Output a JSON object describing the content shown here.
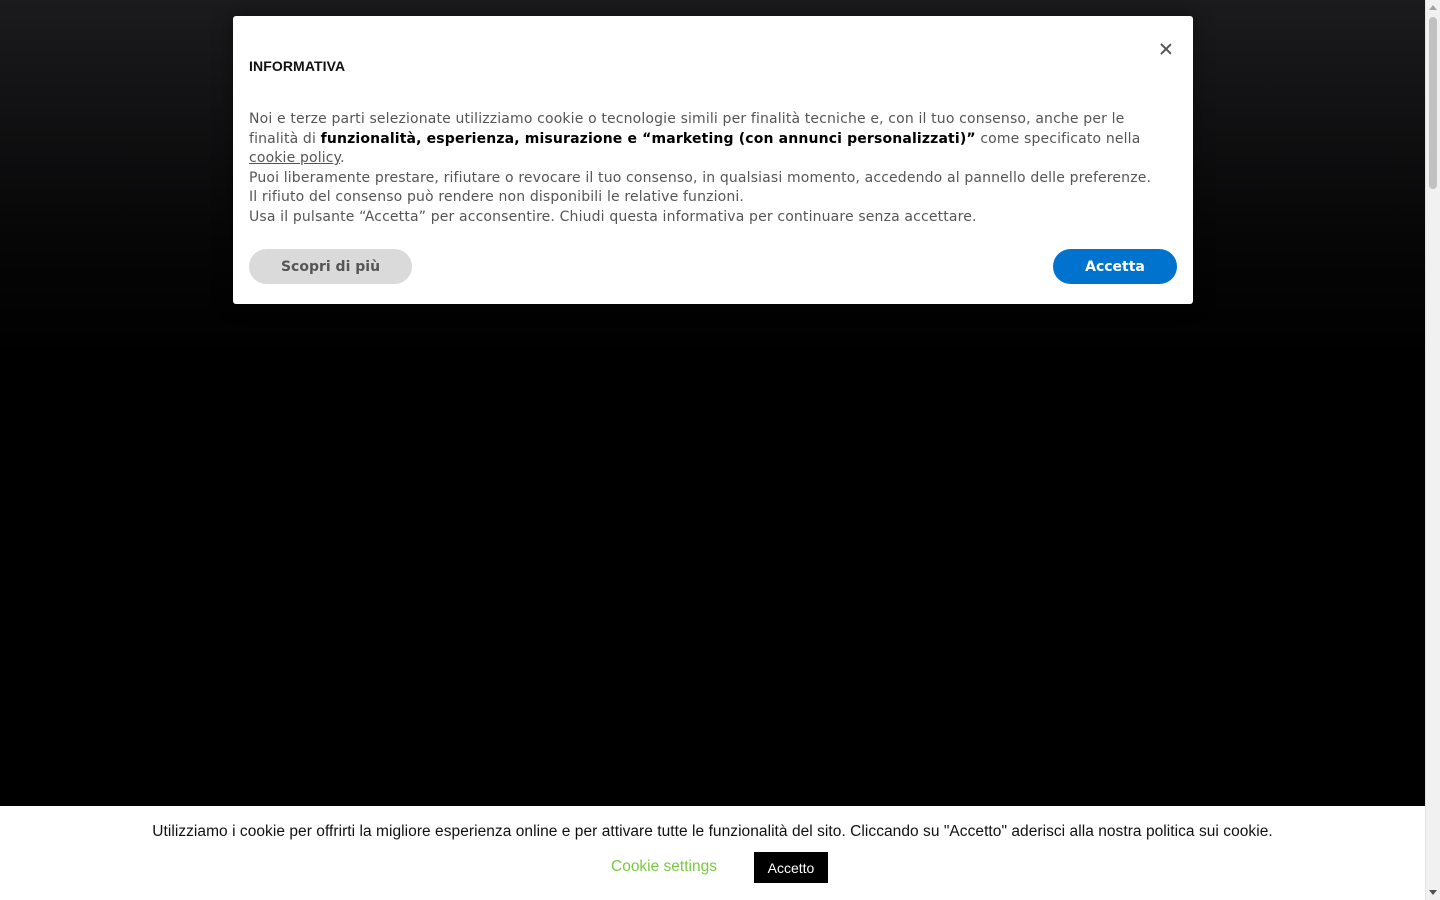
{
  "modal": {
    "title": "INFORMATIVA",
    "close_icon": "close-icon",
    "body": {
      "intro": "Noi e terze parti selezionate utilizziamo cookie o tecnologie simili per finalità tecniche e, con il tuo consenso, anche per le finalità di ",
      "purposes": "funzionalità, esperienza, misurazione e “marketing (con annunci personalizzati)”",
      "after_purposes": " come specificato nella ",
      "policy_link": "cookie policy",
      "after_link": ".",
      "consent": "Puoi liberamente prestare, rifiutare o revocare il tuo consenso, in qualsiasi momento, accedendo al pannello delle preferenze. Il rifiuto del consenso può rendere non disponibili le relative funzioni.",
      "instructions": "Usa il pulsante “Accetta” per acconsentire. Chiudi questa informativa per continuare senza accettare."
    },
    "learn_more_label": "Scopri di più",
    "accept_label": "Accetta",
    "accent_color": "#0073ce"
  },
  "cookie_bar": {
    "message": "Utilizziamo i cookie per offrirti la migliore esperienza online e per attivare tutte le funzionalità del sito. Cliccando su \"Accetto\" aderisci alla nostra politica sui cookie.",
    "settings_label": "Cookie settings",
    "accept_label": "Accetto",
    "settings_color": "#7ac943"
  }
}
